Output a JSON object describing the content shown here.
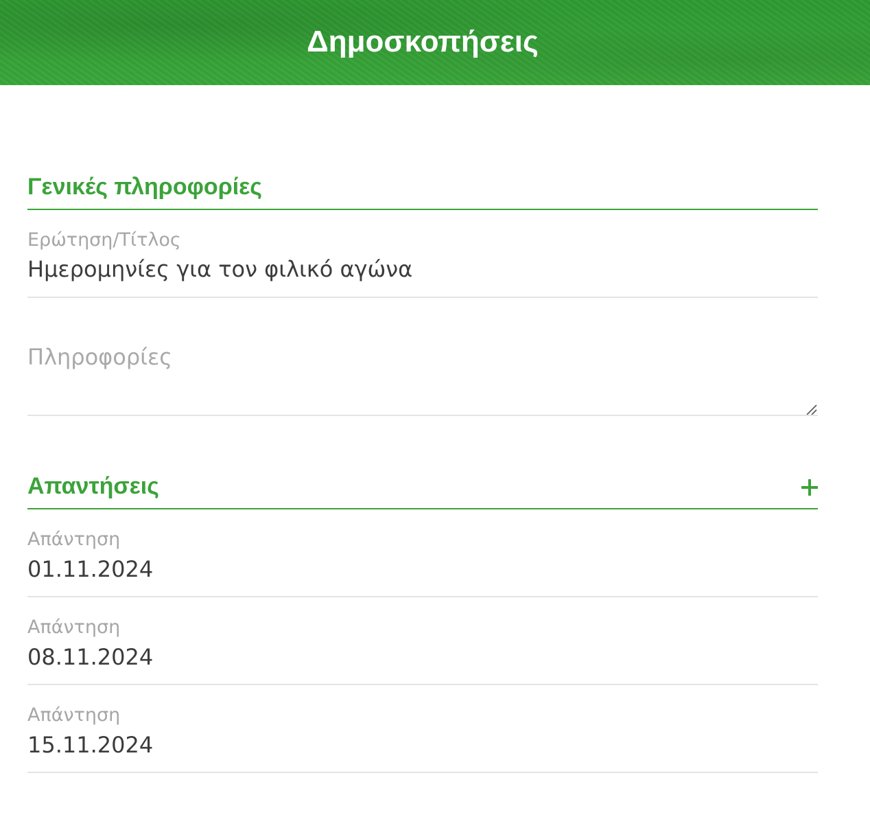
{
  "header": {
    "title": "Δημοσκοπήσεις"
  },
  "general": {
    "section_title": "Γενικές πληροφορίες",
    "question": {
      "label": "Ερώτηση/Τίτλος",
      "value": "Ημερομηνίες για τον φιλικό αγώνα"
    },
    "info": {
      "placeholder": "Πληροφορίες",
      "value": ""
    }
  },
  "answers": {
    "section_title": "Απαντήσεις",
    "add_icon": "plus-icon",
    "items": [
      {
        "label": "Απάντηση",
        "value": "01.11.2024"
      },
      {
        "label": "Απάντηση",
        "value": "08.11.2024"
      },
      {
        "label": "Απάντηση",
        "value": "15.11.2024"
      }
    ]
  },
  "colors": {
    "brand_green": "#3ba33a",
    "label_gray": "#a6a6a6",
    "text_dark": "#3c3c3c",
    "divider": "#e4e4e4"
  }
}
